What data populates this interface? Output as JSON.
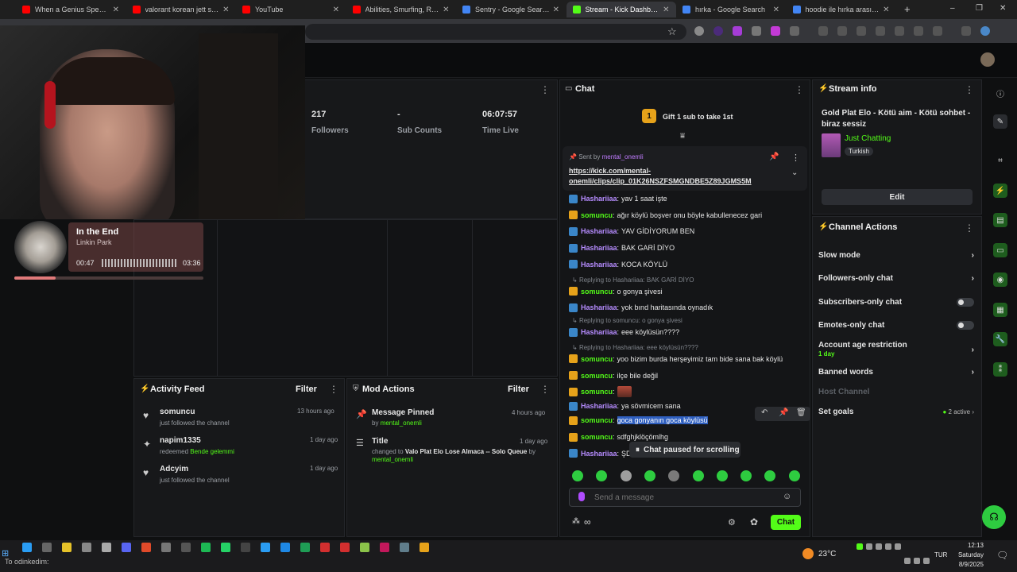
{
  "browser": {
    "tabs": [
      {
        "title": "When a Genius Spearman...",
        "color": "#ff0000"
      },
      {
        "title": "valorant korean jett seold",
        "color": "#ff0000"
      },
      {
        "title": "YouTube",
        "color": "#ff0000"
      },
      {
        "title": "Abilities, Smurfing, Replay",
        "color": "#ff0000"
      },
      {
        "title": "Sentry - Google Search",
        "color": "#4285f4"
      },
      {
        "title": "Stream - Kick Dashboard",
        "color": "#53fc18"
      },
      {
        "title": "hırka - Google Search",
        "color": "#4285f4"
      },
      {
        "title": "hoodie ile hırka arasındak",
        "color": "#4285f4"
      }
    ],
    "new_tab": "+",
    "window_controls": [
      "–",
      "❐",
      "✕"
    ]
  },
  "music": {
    "title": "In the End",
    "artist": "Linkin Park",
    "elapsed": "00:47",
    "total": "03:36",
    "progress": 0.22
  },
  "stats": [
    {
      "value": "217",
      "label": "Followers"
    },
    {
      "value": "-",
      "label": "Sub Counts"
    },
    {
      "value": "06:07:57",
      "label": "Time Live"
    }
  ],
  "activity": {
    "title": "Activity Feed",
    "filter": "Filter",
    "items": [
      {
        "user": "somuncu",
        "action": "just followed the channel",
        "time": "13 hours ago",
        "icon": "heart-icon"
      },
      {
        "user": "napim1335",
        "action": "redeemed",
        "extra": "Bende gelemmi",
        "time": "1 day ago",
        "icon": "reward-icon"
      },
      {
        "user": "Adcyim",
        "action": "just followed the channel",
        "time": "1 day ago",
        "icon": "heart-icon"
      }
    ]
  },
  "mod": {
    "title": "Mod Actions",
    "filter": "Filter",
    "items": [
      {
        "title": "Message Pinned",
        "by": "by",
        "user": "mental_onemli",
        "time": "4 hours ago"
      },
      {
        "title": "Title",
        "changed": "changed to",
        "value": "Valo Plat Elo Lose Almaca -- Solo Queue",
        "by": "by",
        "user": "mental_onemli",
        "time": "1 day ago"
      }
    ]
  },
  "chat": {
    "title": "Chat",
    "gift_badge": "1",
    "gift_text": "Gift 1 sub to take 1st",
    "pinned": {
      "sent_by": "Sent by",
      "user": "mental_onemli",
      "link_line1": "https://kick.com/mental-",
      "link_line2": "onemli/clips/clip_01K26NSZFSMGNDBE5Z89JGMS5M"
    },
    "messages": [
      {
        "user": "Hashariiaa",
        "color": "#b68cff",
        "badge": "kick",
        "text": "yav 1 saat işte"
      },
      {
        "user": "somuncu",
        "color": "#53fc18",
        "badge": "crown",
        "text": "ağır köylü boşver onu böyle kabullenecez gari"
      },
      {
        "user": "Hashariiaa",
        "color": "#b68cff",
        "badge": "kick",
        "text": "YAV GİDİYORUM BEN"
      },
      {
        "user": "Hashariiaa",
        "color": "#b68cff",
        "badge": "kick",
        "text": "BAK GARİ DİYO"
      },
      {
        "user": "Hashariiaa",
        "color": "#b68cff",
        "badge": "kick",
        "text": "KOCA KÖYLÜ"
      },
      {
        "reply": "Replying to Hashariiaa: BAK GARİ DİYO"
      },
      {
        "user": "somuncu",
        "color": "#53fc18",
        "badge": "crown",
        "text": "o gonya şivesi"
      },
      {
        "user": "Hashariiaa",
        "color": "#b68cff",
        "badge": "kick",
        "text": "yok bınd haritasında oynadık"
      },
      {
        "reply": "Replying to somuncu: o gonya şivesi"
      },
      {
        "user": "Hashariiaa",
        "color": "#b68cff",
        "badge": "kick",
        "text": "eee köylüsün????"
      },
      {
        "reply": "Replying to Hashariiaa: eee köylüsün????"
      },
      {
        "user": "somuncu",
        "color": "#53fc18",
        "badge": "crown",
        "text": "yoo bizim burda herşeyimiz tam bide sana bak köylü"
      },
      {
        "user": "somuncu",
        "color": "#53fc18",
        "badge": "crown",
        "text": "ilçe bile değil"
      },
      {
        "user": "somuncu",
        "color": "#53fc18",
        "badge": "crown",
        "text": ""
      },
      {
        "user": "Hashariiaa",
        "color": "#b68cff",
        "badge": "kick",
        "text": "ya sövmicem sana"
      },
      {
        "user": "somuncu",
        "color": "#53fc18",
        "badge": "crown",
        "text": "goca gonyanın goca köylüsü"
      },
      {
        "user": "somuncu",
        "color": "#53fc18",
        "badge": "crown",
        "text": "sdfghjklöçömlhg"
      },
      {
        "user": "Hashariiaa",
        "color": "#b68cff",
        "badge": "kick",
        "text": "ŞD"
      }
    ],
    "paused": "Chat paused for scrolling",
    "placeholder": "Send a message",
    "send": "Chat"
  },
  "stream_info": {
    "title": "Stream info",
    "stream_title": "Gold Plat Elo - Kötü aim - Kötü sohbet - biraz sessiz",
    "category": "Just Chatting",
    "language": "Turkish",
    "edit": "Edit"
  },
  "channel_actions": {
    "title": "Channel Actions",
    "slow": "Slow mode",
    "followers": "Followers-only chat",
    "subscribers": "Subscribers-only chat",
    "emotes": "Emotes-only chat",
    "account_age": "Account age restriction",
    "account_age_value": "1 day",
    "banned": "Banned words",
    "host": "Host Channel",
    "goals": "Set goals",
    "goals_active": "2 active"
  },
  "taskbar": {
    "weather": "23°C",
    "lang": "TUR",
    "time": "12:13",
    "day": "Saturday",
    "date": "8/9/2025",
    "ticker": "To odinkedim:"
  }
}
